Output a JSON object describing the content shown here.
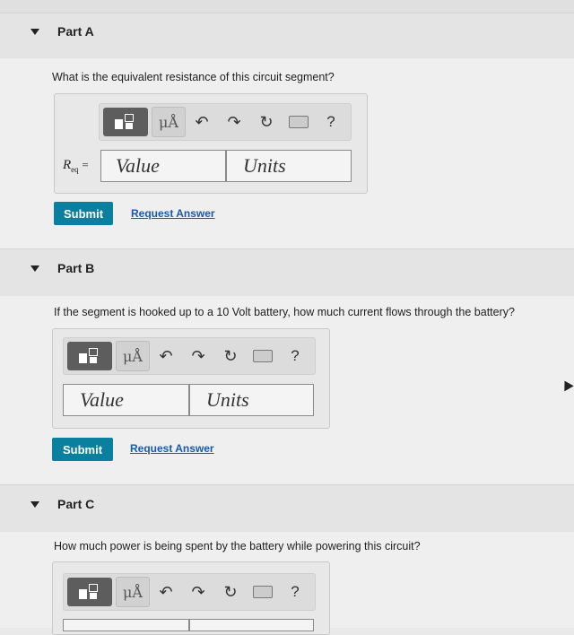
{
  "parts": [
    {
      "title": "Part A",
      "question": "What is the equivalent resistance of this circuit segment?",
      "input_label_main": "R",
      "input_label_sub": "eq",
      "input_label_eq": "=",
      "value_placeholder": "Value",
      "units_placeholder": "Units",
      "submit": "Submit",
      "request": "Request Answer"
    },
    {
      "title": "Part B",
      "question": "If the segment is hooked up to a 10 Volt battery, how much current flows through the battery?",
      "value_placeholder": "Value",
      "units_placeholder": "Units",
      "submit": "Submit",
      "request": "Request Answer"
    },
    {
      "title": "Part C",
      "question": "How much power is being spent by the battery while powering this circuit?"
    }
  ],
  "toolbar": {
    "mu_label": "μÅ",
    "help": "?",
    "icons": [
      "templates-icon",
      "units-icon",
      "undo-icon",
      "redo-icon",
      "reset-icon",
      "keyboard-icon",
      "help-icon"
    ]
  }
}
